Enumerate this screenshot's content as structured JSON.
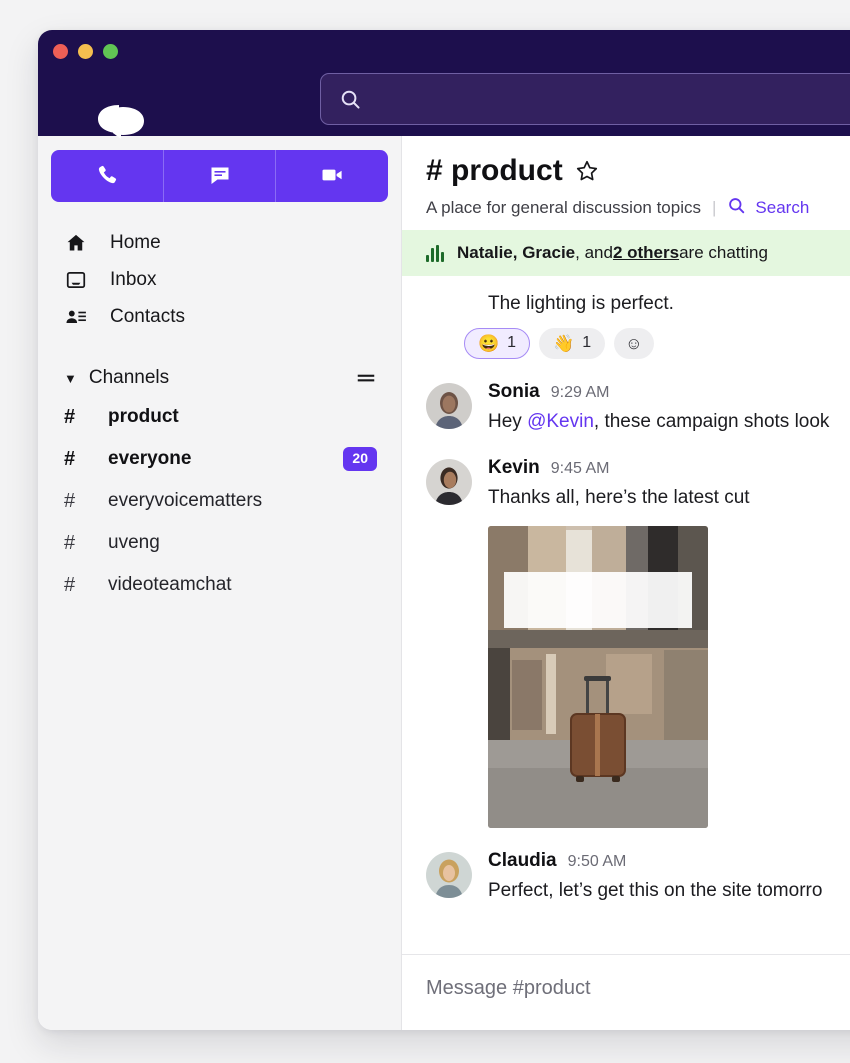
{
  "window": {
    "traffic_lights": [
      "close",
      "minimize",
      "zoom"
    ],
    "logo_name": "chat-bubbles-logo",
    "titlebar_color": "#1d0f4d"
  },
  "search": {
    "value": "",
    "placeholder": "",
    "icon": "search-icon"
  },
  "sidebar": {
    "quick_actions": [
      {
        "name": "call",
        "icon": "phone-icon"
      },
      {
        "name": "message",
        "icon": "chat-icon"
      },
      {
        "name": "video",
        "icon": "video-camera-icon"
      }
    ],
    "nav": [
      {
        "label": "Home",
        "icon": "home-icon"
      },
      {
        "label": "Inbox",
        "icon": "inbox-icon"
      },
      {
        "label": "Contacts",
        "icon": "contacts-icon"
      }
    ],
    "section": {
      "label": "Channels",
      "caret": "▼",
      "more_icon": "equals-menu-icon"
    },
    "channels": [
      {
        "hash": "#",
        "name": "product",
        "unread": true,
        "badge": ""
      },
      {
        "hash": "#",
        "name": "everyone",
        "unread": true,
        "badge": "20"
      },
      {
        "hash": "#",
        "name": "everyvoicematters",
        "unread": false,
        "badge": ""
      },
      {
        "hash": "#",
        "name": "uveng",
        "unread": false,
        "badge": ""
      },
      {
        "hash": "#",
        "name": "videoteamchat",
        "unread": false,
        "badge": ""
      }
    ]
  },
  "channel": {
    "hash": "#",
    "title": "product",
    "star_icon": "star-outline-icon",
    "topic": "A place for general discussion topics",
    "divider": "|",
    "search_link": "Search",
    "search_link_icon": "search-icon"
  },
  "huddle": {
    "icon": "audio-bars-icon",
    "names": "Natalie, Gracie",
    "connector": ", and ",
    "others": "2 others",
    "suffix": " are chatting"
  },
  "messages": {
    "partial_top": {
      "text": "The lighting is perfect.",
      "reactions": [
        {
          "emoji": "😀",
          "count": "1",
          "selected": true
        },
        {
          "emoji": "👋",
          "count": "1",
          "selected": false
        },
        {
          "emoji": "☺",
          "count": "",
          "selected": false,
          "add": true
        }
      ]
    },
    "list": [
      {
        "author": "Sonia",
        "time": "9:29 AM",
        "text_before": "Hey ",
        "mention": "@Kevin",
        "text_after": ", these campaign shots look",
        "avatar": "avatar-sonia",
        "has_image": false
      },
      {
        "author": "Kevin",
        "time": "9:45 AM",
        "text_before": "Thanks all, here’s the latest cut",
        "mention": "",
        "text_after": "",
        "avatar": "avatar-kevin",
        "has_image": true,
        "image_alt": "suitcase-in-urban-plaza-photo"
      },
      {
        "author": "Claudia",
        "time": "9:50 AM",
        "text_before": "Perfect, let’s get this on the site tomorro",
        "mention": "",
        "text_after": "",
        "avatar": "avatar-claudia",
        "has_image": false
      }
    ]
  },
  "composer": {
    "placeholder": "Message #product"
  },
  "colors": {
    "accent": "#6436f0",
    "titlebar": "#1d0f4d",
    "search_field": "#33215f",
    "huddle_banner": "#e4f7df",
    "badge": "#6436f0",
    "sidebar_bg": "#f4f4f5",
    "page_bg": "#f3f3f4"
  }
}
